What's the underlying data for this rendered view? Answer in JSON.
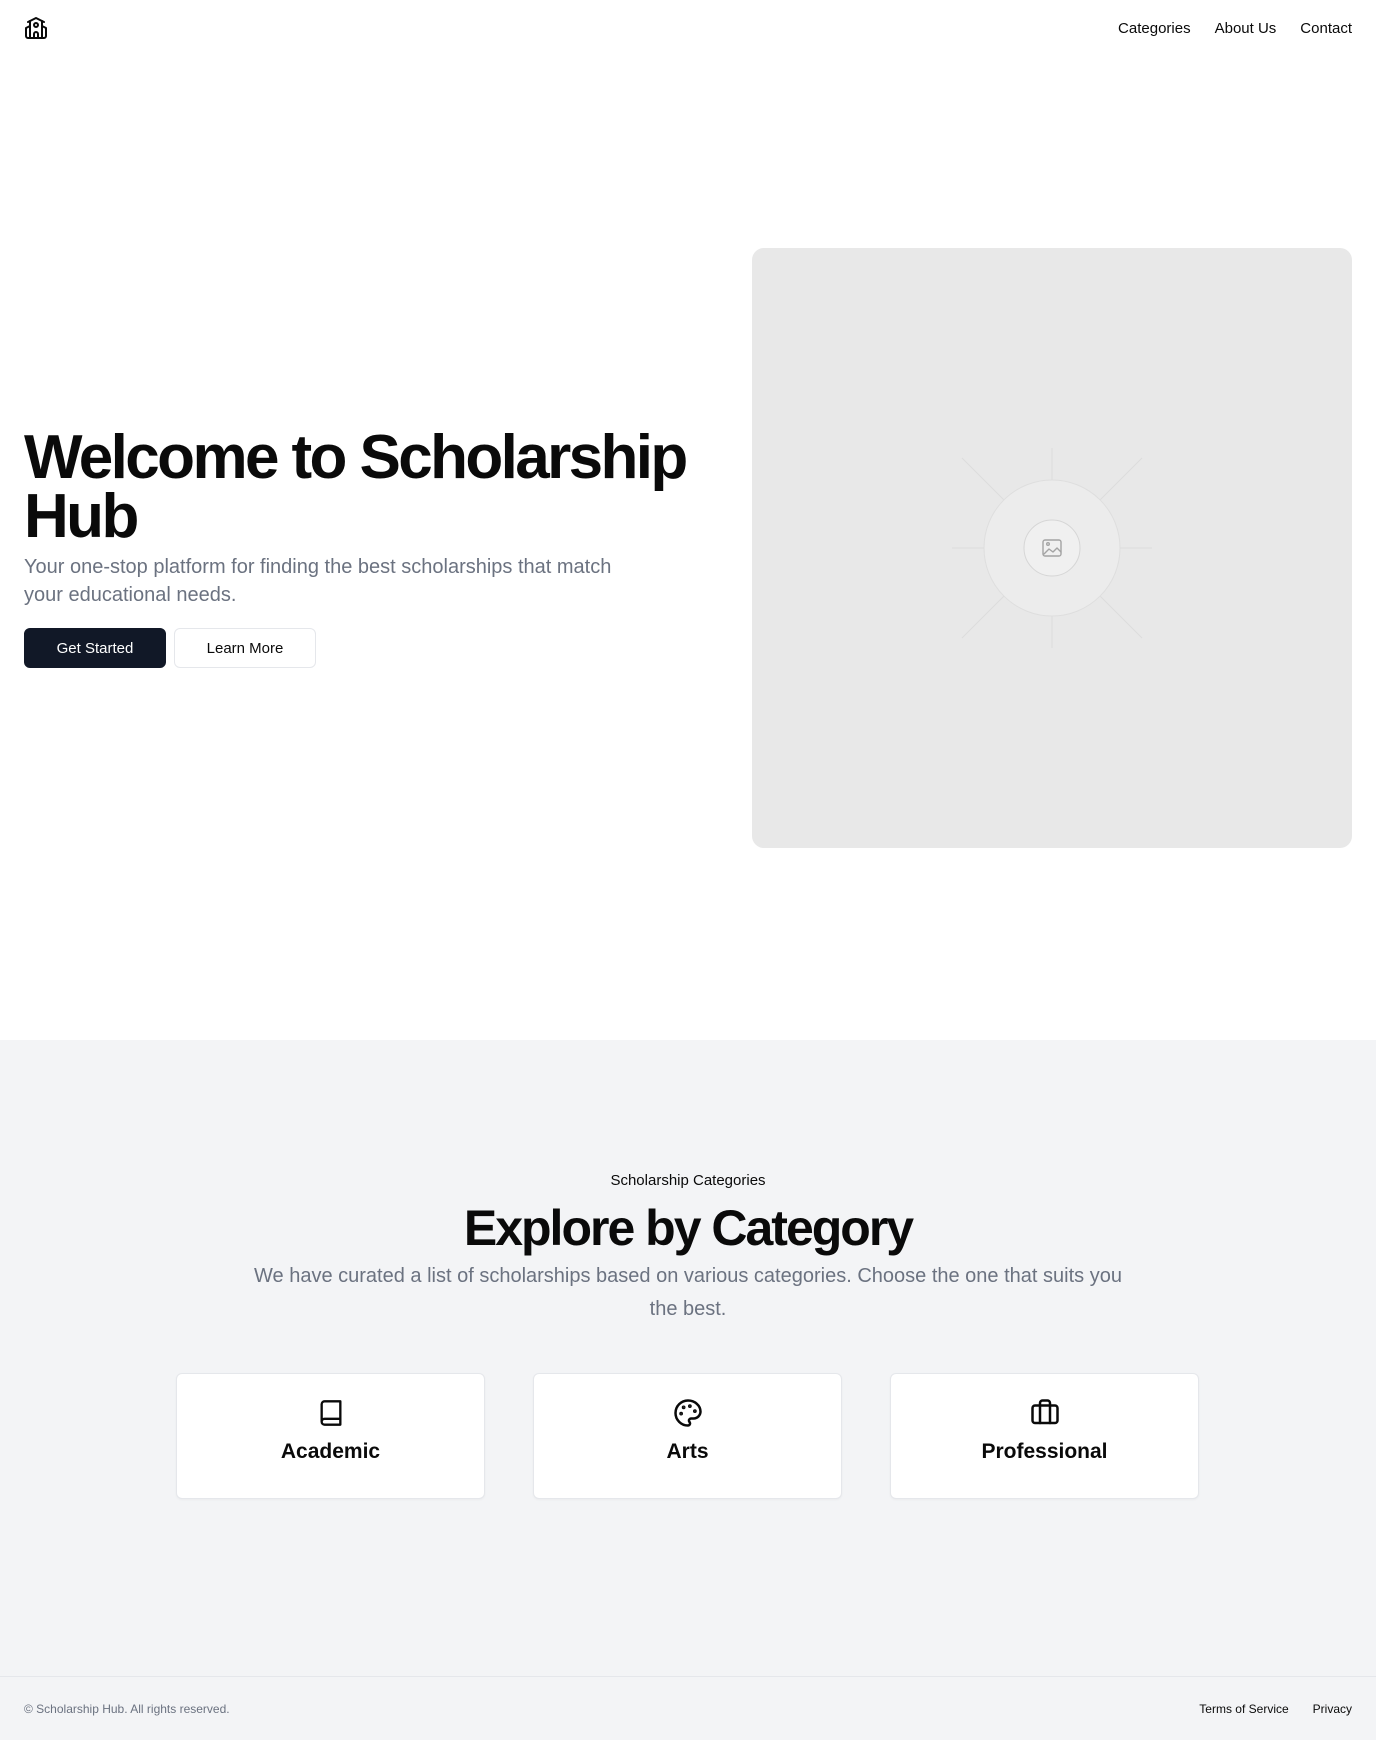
{
  "header": {
    "logo_icon": "school-building-icon",
    "nav": [
      {
        "label": "Categories"
      },
      {
        "label": "About Us"
      },
      {
        "label": "Contact"
      }
    ]
  },
  "hero": {
    "title": "Welcome to Scholarship Hub",
    "subtitle": "Your one-stop platform for finding the best scholarships that match your educational needs.",
    "primary_button": "Get Started",
    "secondary_button": "Learn More",
    "image_icon": "image-placeholder-icon"
  },
  "categories": {
    "eyebrow": "Scholarship Categories",
    "title": "Explore by Category",
    "subtitle": "We have curated a list of scholarships based on various categories. Choose the one that suits you the best.",
    "cards": [
      {
        "label": "Academic",
        "icon": "book-icon"
      },
      {
        "label": "Arts",
        "icon": "palette-icon"
      },
      {
        "label": "Professional",
        "icon": "briefcase-icon"
      }
    ]
  },
  "footer": {
    "copyright": "© Scholarship Hub. All rights reserved.",
    "links": [
      {
        "label": "Terms of Service"
      },
      {
        "label": "Privacy"
      }
    ]
  },
  "colors": {
    "primary_button_bg": "#111827",
    "muted_text": "#6b7280",
    "section_bg": "#f3f4f6",
    "image_bg": "#e8e8e8"
  }
}
